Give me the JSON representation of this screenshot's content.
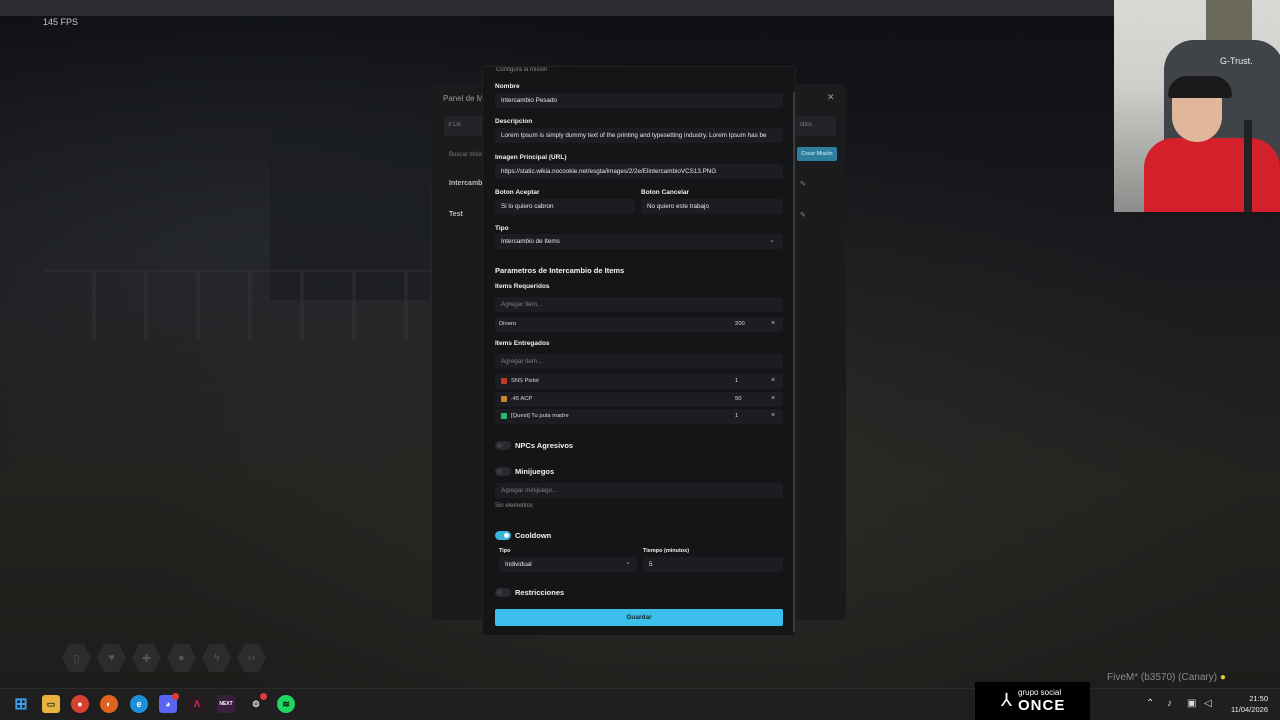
{
  "game": {
    "fps": "145 FPS",
    "build_label": "FiveM* (b3570) (Canary)",
    "build_icon": "banana-icon"
  },
  "under_panel": {
    "title": "Panel de M",
    "tab_left": "≡ Lis",
    "tab_right": "stics",
    "search_placeholder": "Buscar misio",
    "create_button": "Crear Misión",
    "rows": [
      "Intercamb",
      "Test"
    ]
  },
  "webcam": {
    "sponsor": "G-Trust."
  },
  "modal": {
    "header": "Configura la misión",
    "nombre": {
      "label": "Nombre",
      "value": "Intercambio Pesado"
    },
    "descripcion": {
      "label": "Descripcion",
      "value": "Lorem Ipsum is simply dummy text of the printing and typesetting industry. Lorem Ipsum has be"
    },
    "imagen": {
      "label": "Imagen Principal (URL)",
      "value": "https://static.wikia.nocookie.net/esgta/images/2/2e/ElintercambioVCS13.PNG"
    },
    "boton_aceptar": {
      "label": "Boton Aceptar",
      "value": "Si lo quiero cabron"
    },
    "boton_cancelar": {
      "label": "Boton Cancelar",
      "value": "No quiero este trabajo"
    },
    "tipo": {
      "label": "Tipo",
      "value": "Intercambio de Items"
    },
    "params_title": "Parametros de Intercambio de Items",
    "items_requeridos": {
      "label": "Items Requeridos",
      "placeholder": "Agregar item...",
      "rows": [
        {
          "name": "Dinero",
          "qty": "200"
        }
      ]
    },
    "items_entregados": {
      "label": "Items Entregados",
      "placeholder": "Agregar item...",
      "rows": [
        {
          "name": "SNS Pistol",
          "qty": "1",
          "color": "#c0392b"
        },
        {
          "name": ".45 ACP",
          "qty": "50",
          "color": "#c9862b"
        },
        {
          "name": "[Quest] Tu puta madre",
          "qty": "1",
          "color": "#2bb673"
        }
      ]
    },
    "npcs": {
      "label": "NPCs Agresivos",
      "on": false
    },
    "minijuegos": {
      "label": "Minijuegos",
      "on": false,
      "placeholder": "Agregar minijuego...",
      "empty": "Sin elementos"
    },
    "cooldown": {
      "label": "Cooldown",
      "on": true,
      "tipo_label": "Tipo",
      "tipo_value": "Individual",
      "tiempo_label": "Tiempo (minutos)",
      "tiempo_value": "5"
    },
    "restricciones": {
      "label": "Restricciones",
      "on": false
    },
    "save": "Guardar",
    "remove_symbol": "×",
    "chevron": "⌄"
  },
  "taskbar": {
    "discord_badge": "99+",
    "sponsor_small": "grupo social",
    "sponsor_big": "ONCE",
    "time": "21:50",
    "date": "11/04/2026"
  },
  "colors": {
    "accent": "#3cbfea",
    "modal_bg": "#141517",
    "input_bg": "#1c1d20"
  }
}
